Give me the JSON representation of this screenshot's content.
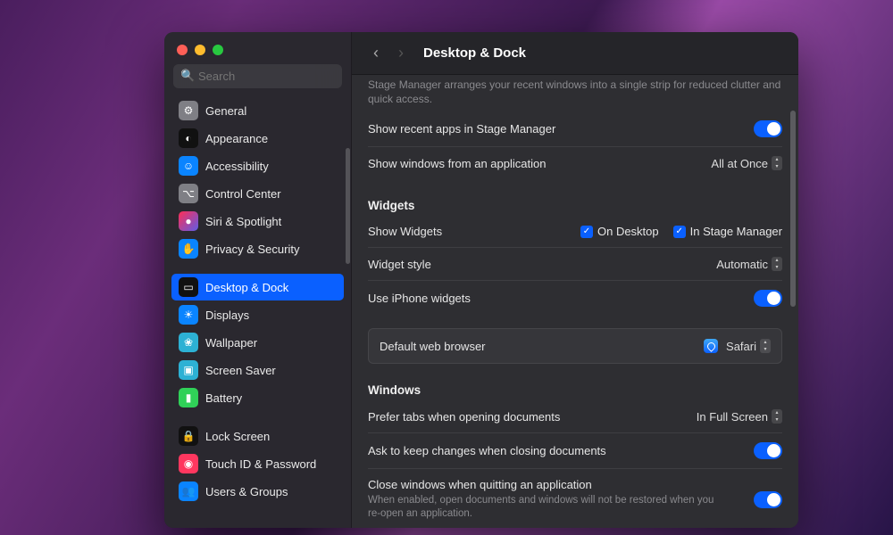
{
  "title": "Desktop & Dock",
  "search_placeholder": "Search",
  "sidebar": {
    "items": [
      {
        "id": "general",
        "label": "General",
        "bg": "#7f7f85",
        "glyph": "⚙"
      },
      {
        "id": "appearance",
        "label": "Appearance",
        "bg": "#111",
        "glyph": "◐"
      },
      {
        "id": "accessibility",
        "label": "Accessibility",
        "bg": "#0a84ff",
        "glyph": "☺"
      },
      {
        "id": "control-center",
        "label": "Control Center",
        "bg": "#7f7f85",
        "glyph": "⌥"
      },
      {
        "id": "siri-spotlight",
        "label": "Siri & Spotlight",
        "bg": "linear-gradient(135deg,#ff2d55,#5e5ce6)",
        "glyph": "●"
      },
      {
        "id": "privacy-security",
        "label": "Privacy & Security",
        "bg": "#0a84ff",
        "glyph": "✋"
      },
      {
        "id": "desktop-dock",
        "label": "Desktop & Dock",
        "bg": "#111",
        "glyph": "▭",
        "selected": true
      },
      {
        "id": "displays",
        "label": "Displays",
        "bg": "#0a84ff",
        "glyph": "☀"
      },
      {
        "id": "wallpaper",
        "label": "Wallpaper",
        "bg": "#2db1d4",
        "glyph": "❀"
      },
      {
        "id": "screen-saver",
        "label": "Screen Saver",
        "bg": "#2db1d4",
        "glyph": "▣"
      },
      {
        "id": "battery",
        "label": "Battery",
        "bg": "#30d158",
        "glyph": "▮"
      },
      {
        "id": "lock-screen",
        "label": "Lock Screen",
        "bg": "#111",
        "glyph": "🔒"
      },
      {
        "id": "touch-id",
        "label": "Touch ID & Password",
        "bg": "#ff375f",
        "glyph": "◉"
      },
      {
        "id": "users-groups",
        "label": "Users & Groups",
        "bg": "#0a84ff",
        "glyph": "👥"
      }
    ],
    "gap_after": [
      "privacy-security",
      "battery"
    ]
  },
  "stage_manager": {
    "desc": "Stage Manager arranges your recent windows into a single strip for reduced clutter and quick access.",
    "show_recent_label": "Show recent apps in Stage Manager",
    "show_recent_on": true,
    "show_windows_label": "Show windows from an application",
    "show_windows_value": "All at Once"
  },
  "widgets": {
    "heading": "Widgets",
    "show_label": "Show Widgets",
    "on_desktop_label": "On Desktop",
    "in_stage_label": "In Stage Manager",
    "style_label": "Widget style",
    "style_value": "Automatic",
    "use_iphone_label": "Use iPhone widgets",
    "use_iphone_on": true
  },
  "default_browser": {
    "label": "Default web browser",
    "value": "Safari"
  },
  "windows": {
    "heading": "Windows",
    "prefer_tabs_label": "Prefer tabs when opening documents",
    "prefer_tabs_value": "In Full Screen",
    "ask_keep_label": "Ask to keep changes when closing documents",
    "ask_keep_on": true,
    "close_quit_label": "Close windows when quitting an application",
    "close_quit_desc": "When enabled, open documents and windows will not be restored when you re-open an application.",
    "close_quit_on": true
  }
}
